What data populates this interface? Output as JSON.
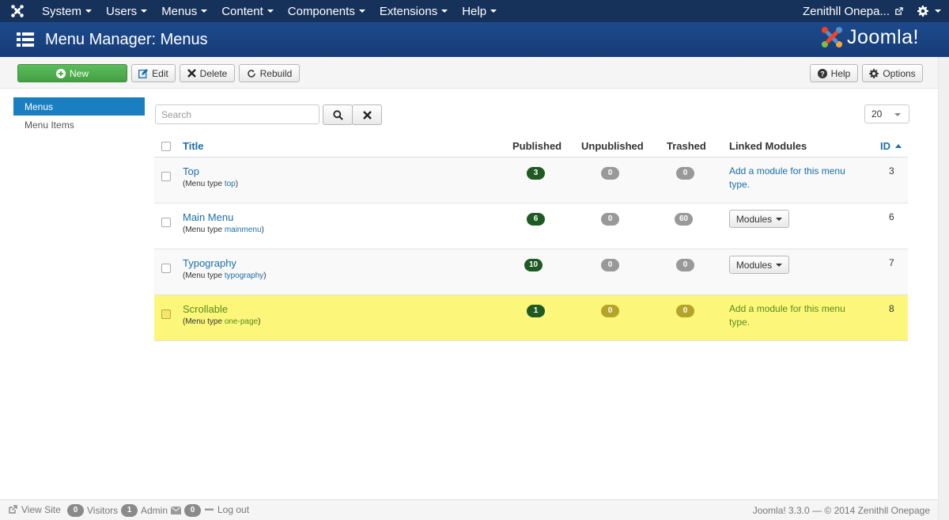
{
  "navbar": {
    "menus": [
      {
        "label": "System"
      },
      {
        "label": "Users"
      },
      {
        "label": "Menus"
      },
      {
        "label": "Content"
      },
      {
        "label": "Components"
      },
      {
        "label": "Extensions"
      },
      {
        "label": "Help"
      }
    ],
    "site_name": "Zenithll Onepa..."
  },
  "header": {
    "title": "Menu Manager: Menus",
    "brand": "Joomla!"
  },
  "toolbar": {
    "new_label": "New",
    "edit_label": "Edit",
    "delete_label": "Delete",
    "rebuild_label": "Rebuild",
    "help_label": "Help",
    "options_label": "Options"
  },
  "sidebar": {
    "items": [
      {
        "label": "Menus",
        "active": true
      },
      {
        "label": "Menu Items",
        "active": false
      }
    ]
  },
  "filter": {
    "search_placeholder": "Search",
    "limit": "20"
  },
  "table": {
    "columns": {
      "title": "Title",
      "published": "Published",
      "unpublished": "Unpublished",
      "trashed": "Trashed",
      "linked_modules": "Linked Modules",
      "id": "ID"
    },
    "type_prefix": "(Menu type ",
    "type_suffix": ")",
    "add_module_text": "Add a module for this menu type.",
    "modules_button": "Modules",
    "rows": [
      {
        "title": "Top",
        "menutype": "top",
        "published": "3",
        "unpublished": "0",
        "trashed": "0",
        "linked": "add",
        "id": "3"
      },
      {
        "title": "Main Menu",
        "menutype": "mainmenu",
        "published": "6",
        "unpublished": "0",
        "trashed": "60",
        "linked": "modules",
        "id": "6"
      },
      {
        "title": "Typography",
        "menutype": "typography",
        "published": "10",
        "unpublished": "0",
        "trashed": "0",
        "linked": "modules",
        "id": "7"
      },
      {
        "title": "Scrollable",
        "menutype": "one-page",
        "published": "1",
        "unpublished": "0",
        "trashed": "0",
        "linked": "add",
        "id": "8",
        "highlighted": true
      }
    ]
  },
  "status": {
    "view_site": "View Site",
    "visitors_count": "0",
    "visitors_label": "Visitors",
    "admin_count": "1",
    "admin_label": "Admin",
    "messages_count": "0",
    "logout_label": "Log out",
    "copyright": "Joomla! 3.3.0  —  © 2014 Zenithll Onepage"
  },
  "colors": {
    "navbar": "#17325a",
    "header": "#1d4a8e",
    "active": "#1a7fc1",
    "link": "#1a6fa8",
    "new_button": "#4cae4c",
    "published_badge": "#1f5a24",
    "highlight_row": "#fcf77a"
  }
}
